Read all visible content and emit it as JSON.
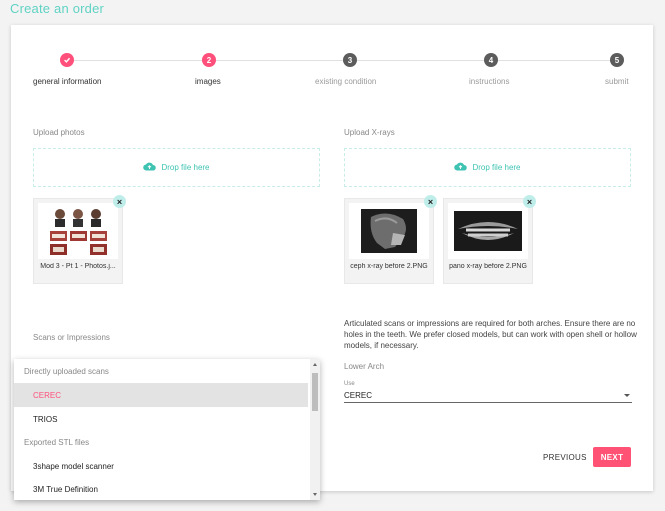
{
  "page_title": "Create an order",
  "steps": [
    {
      "number": "",
      "label": "general information",
      "state": "done"
    },
    {
      "number": "2",
      "label": "images",
      "state": "active"
    },
    {
      "number": "3",
      "label": "existing condition",
      "state": "todo"
    },
    {
      "number": "4",
      "label": "instructions",
      "state": "todo"
    },
    {
      "number": "5",
      "label": "submit",
      "state": "todo"
    }
  ],
  "upload_photos": {
    "label": "Upload photos",
    "drop_text": "Drop file here",
    "files": [
      {
        "name": "Mod 3 - Pt 1 - Photos.j...",
        "icon": "patient-photos-collage"
      }
    ]
  },
  "upload_xrays": {
    "label": "Upload X-rays",
    "drop_text": "Drop file here",
    "files": [
      {
        "name": "ceph x-ray before 2.PNG",
        "icon": "ceph-xray-image"
      },
      {
        "name": "pano x-ray before 2.PNG",
        "icon": "pano-xray-image"
      }
    ]
  },
  "scans": {
    "label": "Scans or Impressions",
    "info": "Articulated scans or impressions are required for both arches. Ensure there are no holes in the teeth. We prefer closed models, but can work with open shell or hollow models, if necessary.",
    "lower_arch_label": "Lower Arch",
    "use_label": "Use",
    "use_value": "CEREC"
  },
  "dropdown": {
    "items": [
      {
        "type": "group",
        "label": "Directly uploaded scans"
      },
      {
        "type": "option",
        "label": "CEREC",
        "selected": true
      },
      {
        "type": "option",
        "label": "TRIOS"
      },
      {
        "type": "group",
        "label": "Exported STL files"
      },
      {
        "type": "option",
        "label": "3shape model scanner"
      },
      {
        "type": "option",
        "label": "3M True Definition"
      }
    ]
  },
  "buttons": {
    "previous": "PREVIOUS",
    "next": "NEXT"
  },
  "colors": {
    "accent": "#ff4f7b",
    "teal": "#5fd3c4",
    "step_inactive": "#5c5c5c"
  }
}
